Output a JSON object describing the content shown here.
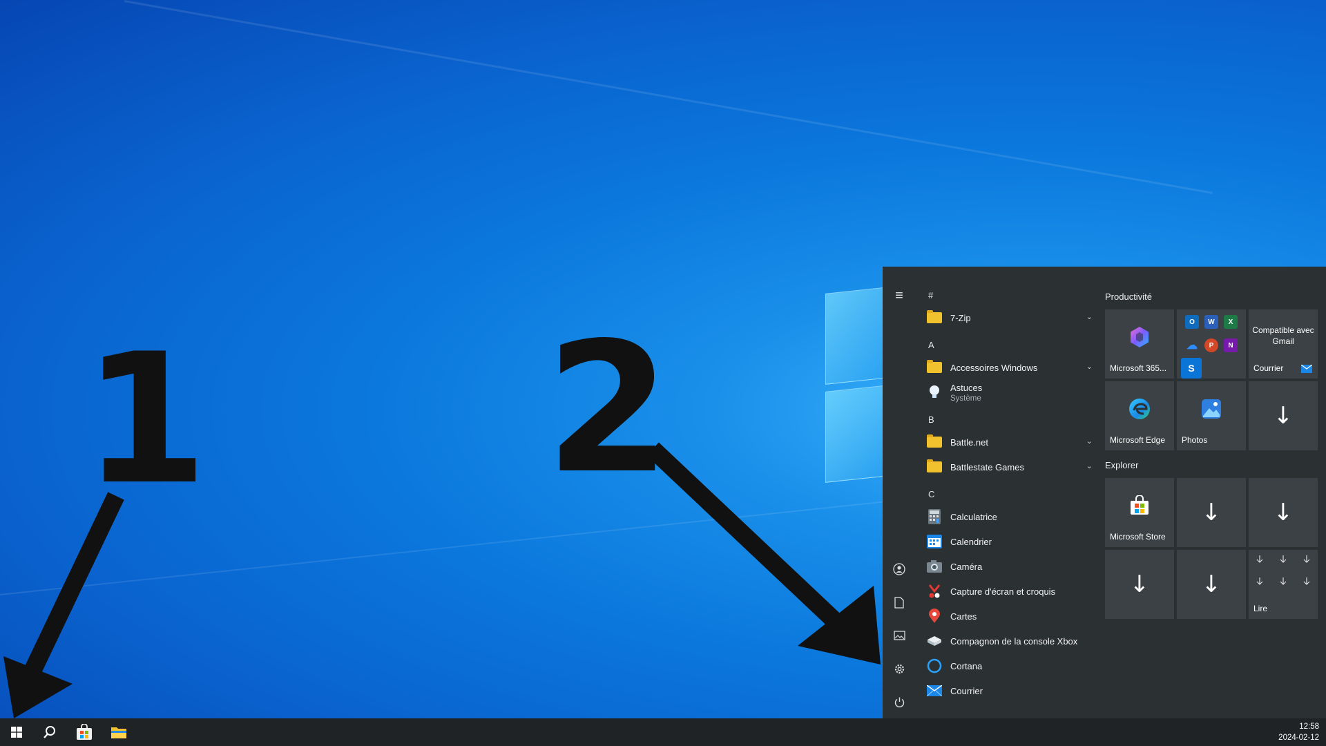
{
  "annotations": {
    "num1": "1",
    "num2": "2"
  },
  "start_menu": {
    "rail": {
      "hamburger": "≡"
    },
    "applist": [
      {
        "type": "letter",
        "text": "#"
      },
      {
        "type": "app",
        "label": "7-Zip",
        "icon": "folder-icon",
        "expandable": true
      },
      {
        "type": "letter",
        "text": "A"
      },
      {
        "type": "app",
        "label": "Accessoires Windows",
        "icon": "folder-icon",
        "expandable": true
      },
      {
        "type": "app",
        "label": "Astuces",
        "sublabel": "Système",
        "icon": "lightbulb-icon"
      },
      {
        "type": "letter",
        "text": "B"
      },
      {
        "type": "app",
        "label": "Battle.net",
        "icon": "folder-icon",
        "expandable": true
      },
      {
        "type": "app",
        "label": "Battlestate Games",
        "icon": "folder-icon",
        "expandable": true
      },
      {
        "type": "letter",
        "text": "C"
      },
      {
        "type": "app",
        "label": "Calculatrice",
        "icon": "calculator-icon"
      },
      {
        "type": "app",
        "label": "Calendrier",
        "icon": "calendar-icon"
      },
      {
        "type": "app",
        "label": "Caméra",
        "icon": "camera-icon"
      },
      {
        "type": "app",
        "label": "Capture d'écran et croquis",
        "icon": "snip-icon"
      },
      {
        "type": "app",
        "label": "Cartes",
        "icon": "maps-pin-icon"
      },
      {
        "type": "app",
        "label": "Compagnon de la console Xbox",
        "icon": "xbox-icon"
      },
      {
        "type": "app",
        "label": "Cortana",
        "icon": "cortana-icon"
      },
      {
        "type": "app",
        "label": "Courrier",
        "icon": "mail-icon"
      }
    ],
    "groups": {
      "productivite": "Productivité",
      "explorer": "Explorer"
    },
    "tiles": {
      "m365": "Microsoft 365...",
      "courrier_header": "Compatible avec Gmail",
      "courrier": "Courrier",
      "edge": "Microsoft Edge",
      "photos": "Photos",
      "store": "Microsoft Store",
      "lire": "Lire"
    }
  },
  "clock": {
    "time": "12:58",
    "date": "2024-02-12"
  },
  "colors": {
    "menu_bg": "#2b3033",
    "tile_bg": "#3b4145",
    "taskbar_bg": "#1f2326"
  }
}
